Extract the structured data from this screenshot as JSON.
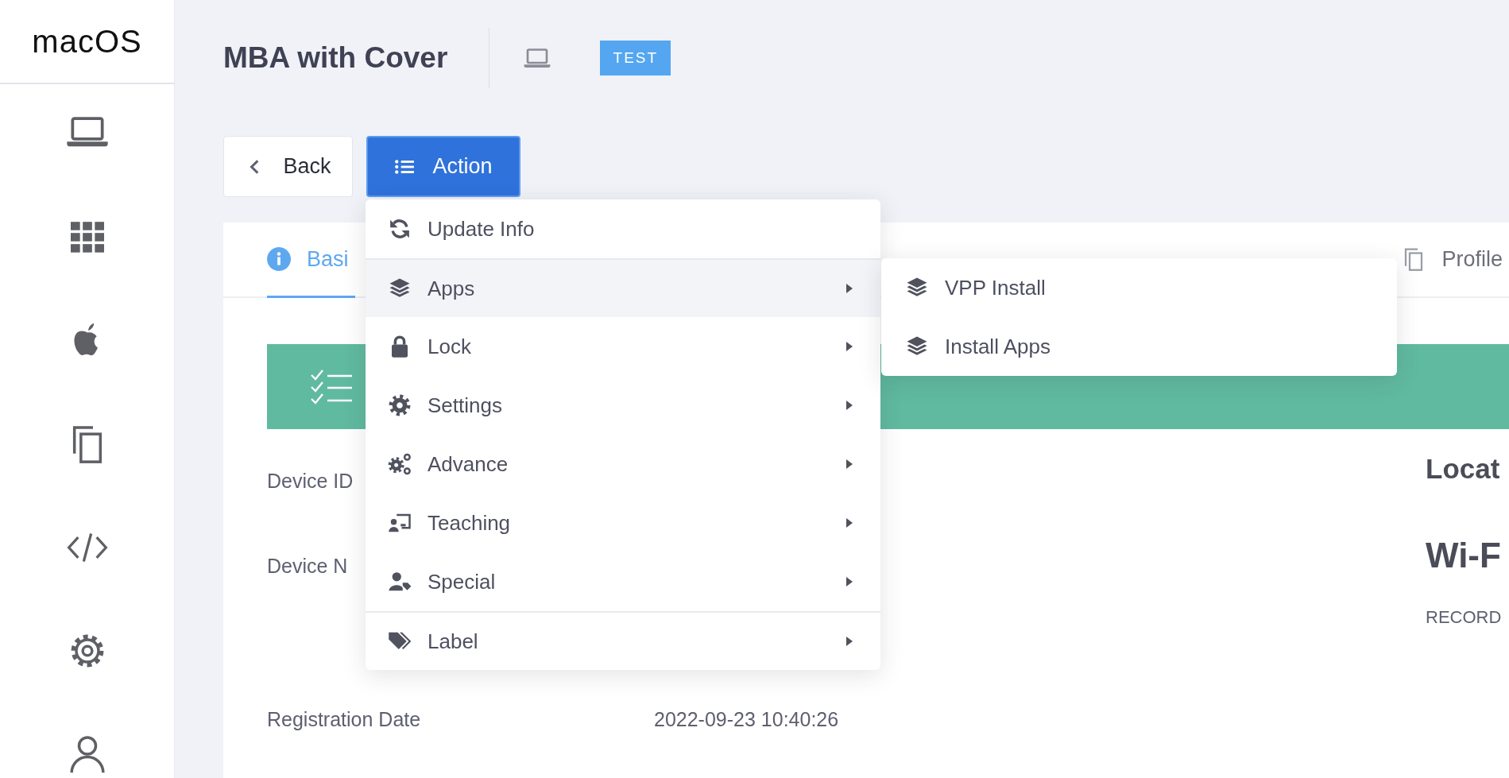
{
  "sidebar": {
    "logo": "macOS",
    "items": [
      {
        "kind": "laptop"
      },
      {
        "kind": "grid"
      },
      {
        "kind": "apple"
      },
      {
        "kind": "copy"
      },
      {
        "kind": "code"
      },
      {
        "kind": "gear"
      },
      {
        "kind": "user"
      }
    ]
  },
  "header": {
    "title": "MBA with Cover",
    "badge": "TEST"
  },
  "buttons": [
    {
      "label": "Back",
      "kind": "back"
    },
    {
      "label": "Action",
      "kind": "action"
    }
  ],
  "tabs": [
    {
      "label": "Basi",
      "kind": "info",
      "selected": true
    },
    {
      "label": "Profile",
      "kind": "copy",
      "selected": false
    }
  ],
  "fields": [
    {
      "label": "Device ID"
    },
    {
      "label": "Device N"
    },
    {
      "label": "Registration Date",
      "value": "2022-09-23 10:40:26"
    }
  ],
  "side_headings": [
    {
      "text": "Locat",
      "kind": "heading"
    },
    {
      "text": "Wi-F",
      "kind": "heading-large"
    },
    {
      "text": "RECORD",
      "kind": "caption"
    }
  ],
  "action_menu": {
    "items": [
      {
        "label": "Update Info",
        "kind": "refresh",
        "has_submenu": false,
        "selected": false,
        "divider_before": false
      },
      {
        "label": "Apps",
        "kind": "layers",
        "has_submenu": true,
        "selected": true,
        "divider_before": true
      },
      {
        "label": "Lock",
        "kind": "lock",
        "has_submenu": true,
        "selected": false,
        "divider_before": false
      },
      {
        "label": "Settings",
        "kind": "gear",
        "has_submenu": true,
        "selected": false,
        "divider_before": false
      },
      {
        "label": "Advance",
        "kind": "gears",
        "has_submenu": true,
        "selected": false,
        "divider_before": false
      },
      {
        "label": "Teaching",
        "kind": "teaching",
        "has_submenu": true,
        "selected": false,
        "divider_before": false
      },
      {
        "label": "Special",
        "kind": "user-tag",
        "has_submenu": true,
        "selected": false,
        "divider_before": false
      },
      {
        "label": "Label",
        "kind": "tag",
        "has_submenu": true,
        "selected": false,
        "divider_before": true
      }
    ]
  },
  "submenu": {
    "items": [
      {
        "label": "VPP Install",
        "kind": "layers"
      },
      {
        "label": "Install Apps",
        "kind": "layers"
      }
    ]
  }
}
